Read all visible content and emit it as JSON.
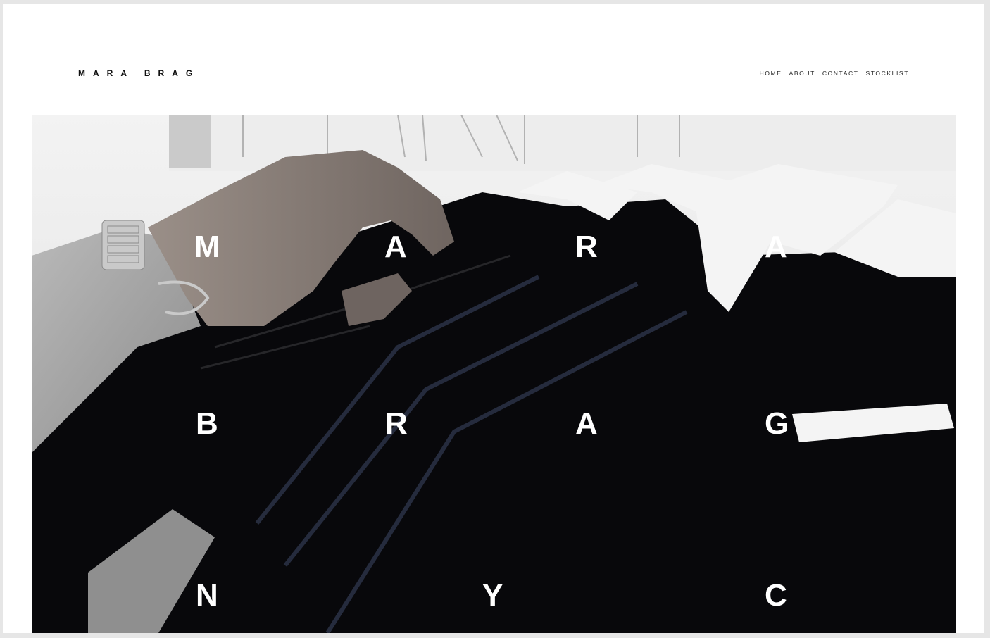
{
  "brand": {
    "name": "MARA BRAG"
  },
  "nav": {
    "items": [
      "HOME",
      "ABOUT",
      "CONTACT",
      "STOCKLIST"
    ]
  },
  "hero": {
    "letters": {
      "row1": [
        "M",
        "A",
        "R",
        "A"
      ],
      "row2": [
        "B",
        "R",
        "A",
        "G"
      ],
      "row3": [
        "N",
        "Y",
        "C"
      ]
    }
  },
  "colors": {
    "background": "#ffffff",
    "text": "#111111",
    "hero_overlay_text": "#ffffff"
  }
}
